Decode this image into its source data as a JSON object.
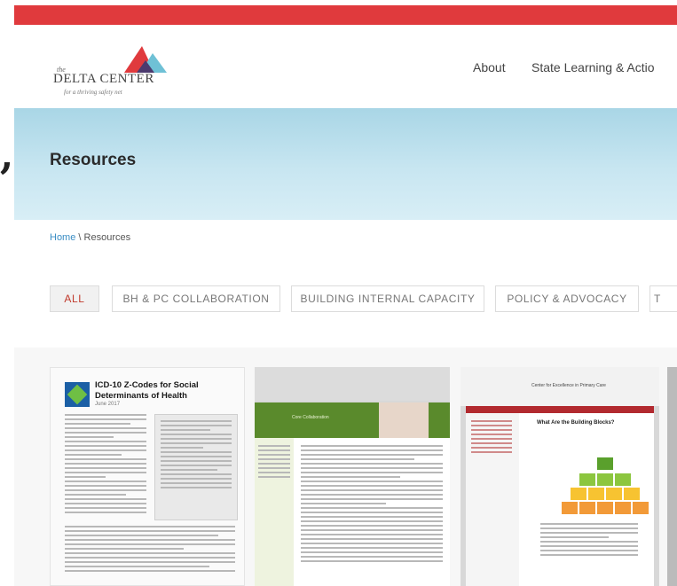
{
  "logo": {
    "the": "the",
    "name": "DELTA CENTER",
    "tagline": "for a thriving safety net",
    "colors": {
      "red": "#e03a3d",
      "teal": "#6fc1d6"
    }
  },
  "nav": {
    "about": "About",
    "state": "State Learning & Actio"
  },
  "hero": {
    "title": "Resources",
    "background": "#b8deeb"
  },
  "breadcrumb": {
    "home": "Home",
    "separator": " \\ ",
    "current": "Resources"
  },
  "tabs": [
    {
      "label": "ALL",
      "active": true
    },
    {
      "label": "BH & PC COLLABORATION",
      "active": false
    },
    {
      "label": "BUILDING INTERNAL CAPACITY",
      "active": false
    },
    {
      "label": "POLICY & ADVOCACY",
      "active": false
    },
    {
      "label": "T",
      "active": false
    }
  ],
  "cards": [
    {
      "title": "ICD-10 Z-Codes for Social Determinants of Health",
      "date": "June 2017"
    },
    {
      "header": "Core Collaboration"
    },
    {
      "header": "Center for Excellence in Primary Care",
      "subtitle": "What Are the Building Blocks?"
    }
  ],
  "colors": {
    "accent_red": "#e03a3d",
    "link_blue": "#3a8dc4"
  }
}
